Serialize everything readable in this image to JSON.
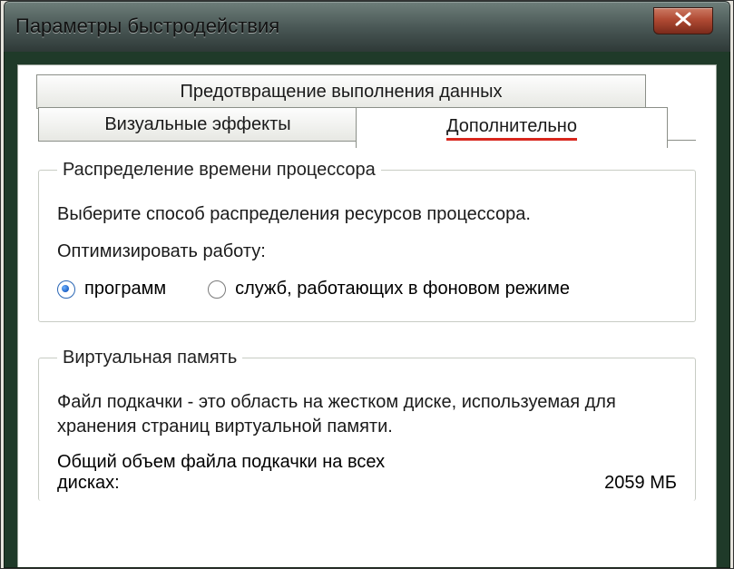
{
  "window": {
    "title": "Параметры быстродействия"
  },
  "tabs": {
    "dep": "Предотвращение выполнения данных",
    "visual": "Визуальные эффекты",
    "advanced": "Дополнительно"
  },
  "cpu": {
    "legend": "Распределение времени процессора",
    "desc": "Выберите способ распределения ресурсов процессора.",
    "optlabel": "Оптимизировать работу:",
    "radios": {
      "programs": "программ",
      "services": "служб, работающих в фоновом режиме"
    }
  },
  "vmem": {
    "legend": "Виртуальная память",
    "desc": "Файл подкачки - это область на жестком диске, используемая для хранения страниц виртуальной памяти.",
    "total_label": "Общий объем файла подкачки на всех дисках:",
    "total_value": "2059 МБ"
  }
}
